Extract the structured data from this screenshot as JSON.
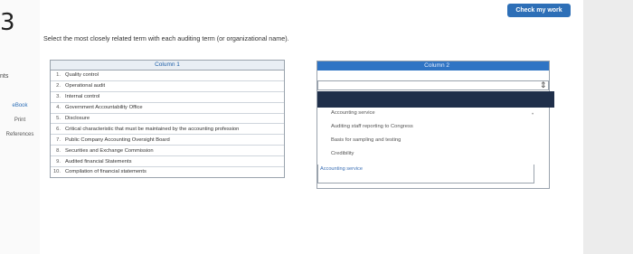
{
  "question": {
    "number": "3",
    "prompt": "Select the most closely related term with each auditing term (or organizational name)."
  },
  "header": {
    "check_label": "Check my work"
  },
  "rail": {
    "pts": "nts",
    "links": [
      "eBook",
      "Print",
      "References"
    ]
  },
  "column1": {
    "header": "Column 1",
    "items": [
      {
        "num": "1.",
        "term": "Quality control"
      },
      {
        "num": "2.",
        "term": "Operational audit"
      },
      {
        "num": "3.",
        "term": "Internal control"
      },
      {
        "num": "4.",
        "term": "Government Accountability Office"
      },
      {
        "num": "5.",
        "term": "Disclosure"
      },
      {
        "num": "6.",
        "term": "Critical characteristic that must be maintained by the accounting profession"
      },
      {
        "num": "7.",
        "term": "Public Company Accounting Oversight Board"
      },
      {
        "num": "8.",
        "term": "Securities and Exchange Commission"
      },
      {
        "num": "9.",
        "term": "Audited financial Statements"
      },
      {
        "num": "10.",
        "term": "Compilation of financial statements"
      }
    ]
  },
  "column2": {
    "header": "Column 2",
    "definitions": [
      "Accounting service",
      "Auditing staff reporting to Congress",
      "Basis for sampling and testing",
      "Credibility"
    ],
    "selected_answer": "Accounting service"
  }
}
